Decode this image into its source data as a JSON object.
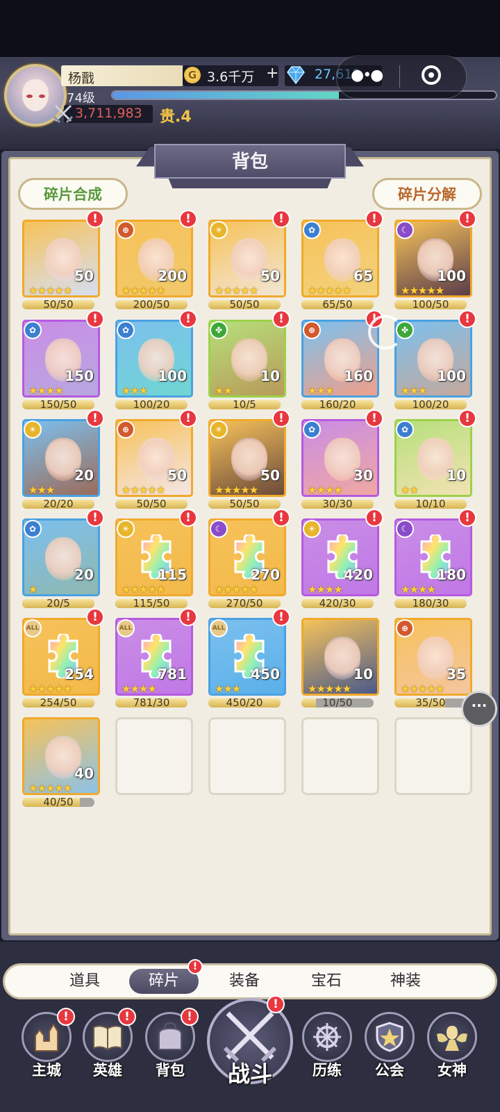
{
  "header": {
    "player_name": "杨戬",
    "level": "74级",
    "power": "3,711,983",
    "noble": "贵.4",
    "gold": "3.6千万",
    "gold_plus": "+",
    "gems": "27,612",
    "exp_progress_pct": 59
  },
  "panel": {
    "title": "背包",
    "compose_button": "碎片合成",
    "decompose_button": "碎片分解"
  },
  "items": [
    {
      "count": "50",
      "progress": "50/50",
      "frame": "gold",
      "element": "none",
      "badge": true,
      "stars": 5,
      "type": "hero",
      "tint": "#d6dff3",
      "fill": 1
    },
    {
      "count": "200",
      "progress": "200/50",
      "frame": "gold",
      "element": "sun",
      "badge": true,
      "stars": 5,
      "type": "hero",
      "tint": "#f2c96a",
      "fill": 1
    },
    {
      "count": "50",
      "progress": "50/50",
      "frame": "gold",
      "element": "light",
      "badge": true,
      "stars": 5,
      "type": "hero",
      "tint": "#f2e6d4",
      "fill": 1
    },
    {
      "count": "65",
      "progress": "65/50",
      "frame": "gold",
      "element": "water",
      "badge": true,
      "stars": 5,
      "type": "hero",
      "tint": "#f4d27e",
      "fill": 1
    },
    {
      "count": "100",
      "progress": "100/50",
      "frame": "gold",
      "element": "dark",
      "badge": true,
      "stars": 5,
      "type": "hero",
      "tint": "#5a3d4a",
      "fill": 1
    },
    {
      "count": "150",
      "progress": "150/50",
      "frame": "purple",
      "element": "water",
      "badge": true,
      "stars": 4,
      "type": "hero",
      "tint": "#b8a8e0",
      "fill": 1
    },
    {
      "count": "100",
      "progress": "100/20",
      "frame": "blue",
      "element": "water",
      "badge": true,
      "stars": 3,
      "type": "hero",
      "tint": "#6fd6d2",
      "fill": 1
    },
    {
      "count": "10",
      "progress": "10/5",
      "frame": "green",
      "element": "wood",
      "badge": true,
      "stars": 2,
      "type": "hero",
      "tint": "#b89a5a",
      "fill": 1
    },
    {
      "count": "160",
      "progress": "160/20",
      "frame": "blue",
      "element": "sun",
      "badge": true,
      "stars": 3,
      "type": "hero",
      "tint": "#f0a08a",
      "fill": 1
    },
    {
      "count": "100",
      "progress": "100/20",
      "frame": "blue",
      "element": "wood",
      "badge": true,
      "stars": 3,
      "type": "hero",
      "tint": "#c6a89a",
      "fill": 1
    },
    {
      "count": "20",
      "progress": "20/20",
      "frame": "blue",
      "element": "light",
      "badge": true,
      "stars": 3,
      "type": "hero",
      "tint": "#9c6b5a",
      "fill": 1
    },
    {
      "count": "50",
      "progress": "50/50",
      "frame": "gold",
      "element": "sun",
      "badge": true,
      "stars": 5,
      "type": "hero",
      "tint": "#f4e6e6",
      "fill": 1
    },
    {
      "count": "50",
      "progress": "50/50",
      "frame": "gold",
      "element": "light",
      "badge": true,
      "stars": 5,
      "type": "hero",
      "tint": "#6b4a3a",
      "fill": 1
    },
    {
      "count": "30",
      "progress": "30/30",
      "frame": "purple",
      "element": "water",
      "badge": true,
      "stars": 4,
      "type": "hero",
      "tint": "#f0a8a0",
      "fill": 1
    },
    {
      "count": "10",
      "progress": "10/10",
      "frame": "green",
      "element": "water",
      "badge": true,
      "stars": 2,
      "type": "hero",
      "tint": "#f2e2b4",
      "fill": 1
    },
    {
      "count": "20",
      "progress": "20/5",
      "frame": "blue",
      "element": "water",
      "badge": true,
      "stars": 1,
      "type": "hero",
      "tint": "#8fb8b0",
      "fill": 1
    },
    {
      "count": "115",
      "progress": "115/50",
      "frame": "gold",
      "element": "light",
      "badge": true,
      "stars": 5,
      "type": "puzzle",
      "tint": "#f3b94a",
      "fill": 1
    },
    {
      "count": "270",
      "progress": "270/50",
      "frame": "gold",
      "element": "dark",
      "badge": true,
      "stars": 5,
      "type": "puzzle",
      "tint": "#f3b94a",
      "fill": 1
    },
    {
      "count": "420",
      "progress": "420/30",
      "frame": "purple",
      "element": "light",
      "badge": true,
      "stars": 4,
      "type": "puzzle",
      "tint": "#c078e6",
      "fill": 1
    },
    {
      "count": "180",
      "progress": "180/30",
      "frame": "purple",
      "element": "dark",
      "badge": true,
      "stars": 4,
      "type": "puzzle",
      "tint": "#c078e6",
      "fill": 1
    },
    {
      "count": "254",
      "progress": "254/50",
      "frame": "gold",
      "element": "all",
      "badge": true,
      "stars": 5,
      "type": "puzzle",
      "tint": "#f3b94a",
      "fill": 1
    },
    {
      "count": "781",
      "progress": "781/30",
      "frame": "purple",
      "element": "all",
      "badge": true,
      "stars": 4,
      "type": "puzzle",
      "tint": "#c078e6",
      "fill": 1
    },
    {
      "count": "450",
      "progress": "450/20",
      "frame": "blue",
      "element": "all",
      "badge": true,
      "stars": 3,
      "type": "puzzle",
      "tint": "#5ab0ea",
      "fill": 1
    },
    {
      "count": "10",
      "progress": "10/50",
      "frame": "gold",
      "element": "none",
      "badge": false,
      "stars": 5,
      "type": "hero",
      "tint": "#4a5a8a",
      "fill": 0.2
    },
    {
      "count": "35",
      "progress": "35/50",
      "frame": "gold",
      "element": "sun",
      "badge": false,
      "stars": 5,
      "type": "hero",
      "tint": "#f4c6a0",
      "fill": 0.7
    },
    {
      "count": "40",
      "progress": "40/50",
      "frame": "gold",
      "element": "none",
      "badge": false,
      "stars": 5,
      "type": "hero",
      "tint": "#8cc2e8",
      "fill": 0.8
    }
  ],
  "element_glyphs": {
    "sun": "⊕",
    "light": "☀",
    "water": "✿",
    "dark": "☾",
    "wood": "✤",
    "all": "ALL"
  },
  "element_colors": {
    "sun": "#d2592c",
    "light": "#e8b52a",
    "water": "#3c7fd0",
    "dark": "#8a4cc8",
    "wood": "#3fa73a",
    "all": "#e8c98a"
  },
  "frame_colors": {
    "gold": "#f6c25a",
    "purple": "#c98de6",
    "blue": "#7cc0ee",
    "green": "#b6e07a"
  },
  "tabs": [
    {
      "label": "道具",
      "active": false,
      "badge": false
    },
    {
      "label": "碎片",
      "active": true,
      "badge": true
    },
    {
      "label": "装备",
      "active": false,
      "badge": false
    },
    {
      "label": "宝石",
      "active": false,
      "badge": false
    },
    {
      "label": "神装",
      "active": false,
      "badge": false
    }
  ],
  "nav": [
    {
      "label": "主城",
      "icon": "castle-icon",
      "badge": true
    },
    {
      "label": "英雄",
      "icon": "book-icon",
      "badge": true
    },
    {
      "label": "背包",
      "icon": "bag-icon",
      "badge": true
    },
    {
      "label": "战斗",
      "icon": "crossed-swords-icon",
      "badge": true
    },
    {
      "label": "历练",
      "icon": "ship-wheel-icon",
      "badge": false
    },
    {
      "label": "公会",
      "icon": "shield-emblem-icon",
      "badge": false
    },
    {
      "label": "女神",
      "icon": "goddess-icon",
      "badge": false
    }
  ],
  "badge_glyph": "!"
}
